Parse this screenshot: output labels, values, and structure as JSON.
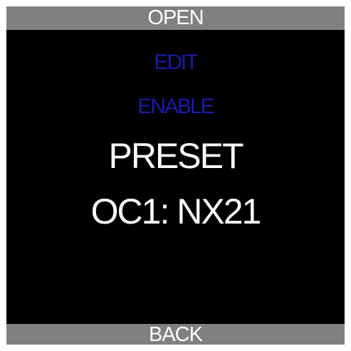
{
  "softkeys": {
    "top_label": "OPEN",
    "bottom_label": "BACK"
  },
  "menu": {
    "items": [
      {
        "label": "EDIT"
      },
      {
        "label": "ENABLE"
      }
    ]
  },
  "display": {
    "title": "PRESET",
    "value": "OC1: NX21"
  },
  "colors": {
    "background": "#000000",
    "softkey_bar": "#808080",
    "menu_text": "#1a1aa8",
    "main_text": "#ffffff"
  }
}
